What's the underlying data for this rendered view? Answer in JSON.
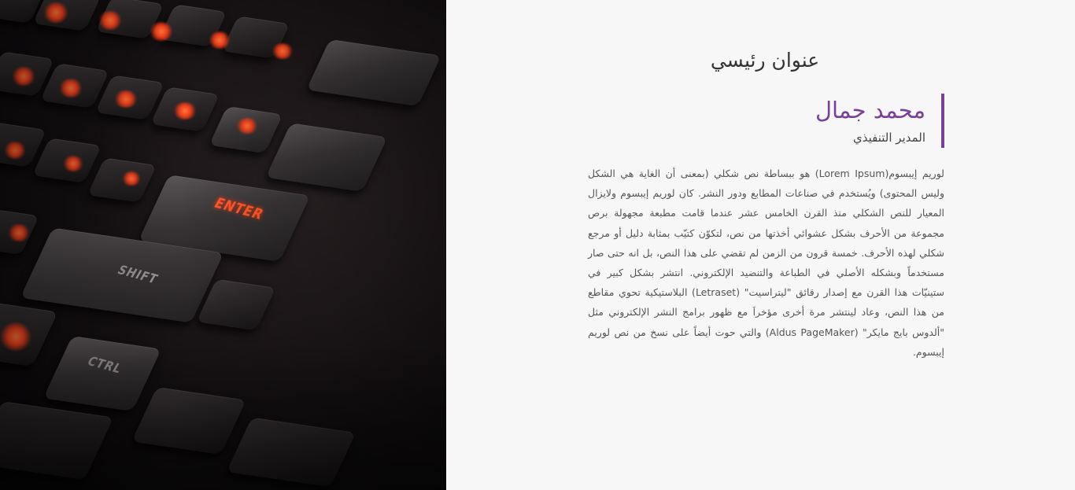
{
  "photo": {
    "alt": "keyboard-photo",
    "keys": {
      "enter": "ENTER",
      "shift": "SHIFT",
      "ctrl": "CTRL"
    }
  },
  "header": {
    "title": "عنوان رئيسي"
  },
  "profile": {
    "name": "محمد جمال",
    "role": "المدير التنفيذي",
    "accent_color": "#7a3f98"
  },
  "body": {
    "paragraph": "لوريم إيبسوم(Lorem Ipsum) هو ببساطة نص شكلي (بمعنى أن الغاية هي الشكل وليس المحتوى) ويُستخدم في صناعات المطابع ودور النشر. كان لوريم إيبسوم ولايزال المعيار للنص الشكلي منذ القرن الخامس عشر عندما قامت مطبعة مجهولة برص مجموعة من الأحرف بشكل عشوائي أخذتها من نص، لتكوّن كتيّب بمثابة دليل أو مرجع شكلي لهذه الأحرف. خمسة قرون من الزمن لم تقضي على هذا النص، بل انه حتى صار مستخدماً وبشكله الأصلي في الطباعة والتنضيد الإلكتروني. انتشر بشكل كبير في ستينيّات هذا القرن مع إصدار رقائق \"ليتراسيت\" (Letraset) البلاستيكية تحوي مقاطع من هذا النص، وعاد لينتشر مرة أخرى مؤخراَ مع ظهور برامج النشر الإلكتروني مثل \"ألدوس بايج مايكر\" (Aldus PageMaker) والتي حوت أيضاً على نسخ من نص لوريم إيبسوم."
  }
}
